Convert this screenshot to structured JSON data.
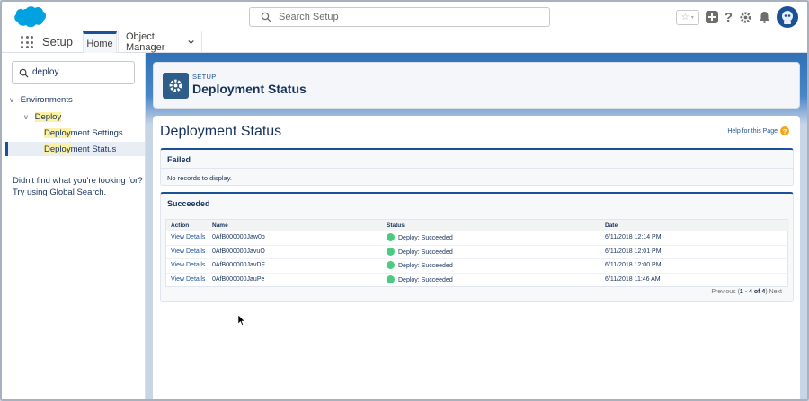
{
  "header": {
    "search_placeholder": "Search Setup",
    "icons": [
      "favorites-icon",
      "add-icon",
      "help-icon",
      "settings-icon",
      "notifications-icon",
      "avatar"
    ]
  },
  "nav": {
    "app_name": "Setup",
    "tabs": [
      {
        "label": "Home",
        "active": true
      },
      {
        "label": "Object Manager"
      }
    ]
  },
  "sidebar": {
    "quick_find": "deploy",
    "tree": {
      "environments": "Environments",
      "deploy": "Deploy",
      "deployment_settings": {
        "highlight": "Deploy",
        "rest": "ment Settings"
      },
      "deployment_status": {
        "highlight": "Deploy",
        "rest": "ment Status"
      }
    },
    "help_line1": "Didn't find what you're looking for?",
    "help_line2": "Try using Global Search."
  },
  "page_header": {
    "eyebrow": "SETUP",
    "title": "Deployment Status"
  },
  "content": {
    "title": "Deployment Status",
    "help_link": "Help for this Page",
    "failed": {
      "title": "Failed",
      "empty": "No records to display."
    },
    "succeeded": {
      "title": "Succeeded",
      "columns": [
        "Action",
        "Name",
        "Status",
        "Date"
      ],
      "rows": [
        {
          "action": "View Details",
          "name": "0AfB000000Jaw0b",
          "status": "Deploy: Succeeded",
          "date": "6/11/2018 12:14 PM"
        },
        {
          "action": "View Details",
          "name": "0AfB000000JavuO",
          "status": "Deploy: Succeeded",
          "date": "6/11/2018 12:01 PM"
        },
        {
          "action": "View Details",
          "name": "0AfB000000JavDF",
          "status": "Deploy: Succeeded",
          "date": "6/11/2018 12:00 PM"
        },
        {
          "action": "View Details",
          "name": "0AfB000000JauPe",
          "status": "Deploy: Succeeded",
          "date": "6/11/2018 11:46 AM"
        }
      ],
      "pager": {
        "prev": "Previous",
        "range": "1 - 4 of 4",
        "next": "Next"
      }
    }
  },
  "colors": {
    "brand": "#1b5297",
    "success": "#4bca81",
    "highlight": "#fbf1a6"
  }
}
